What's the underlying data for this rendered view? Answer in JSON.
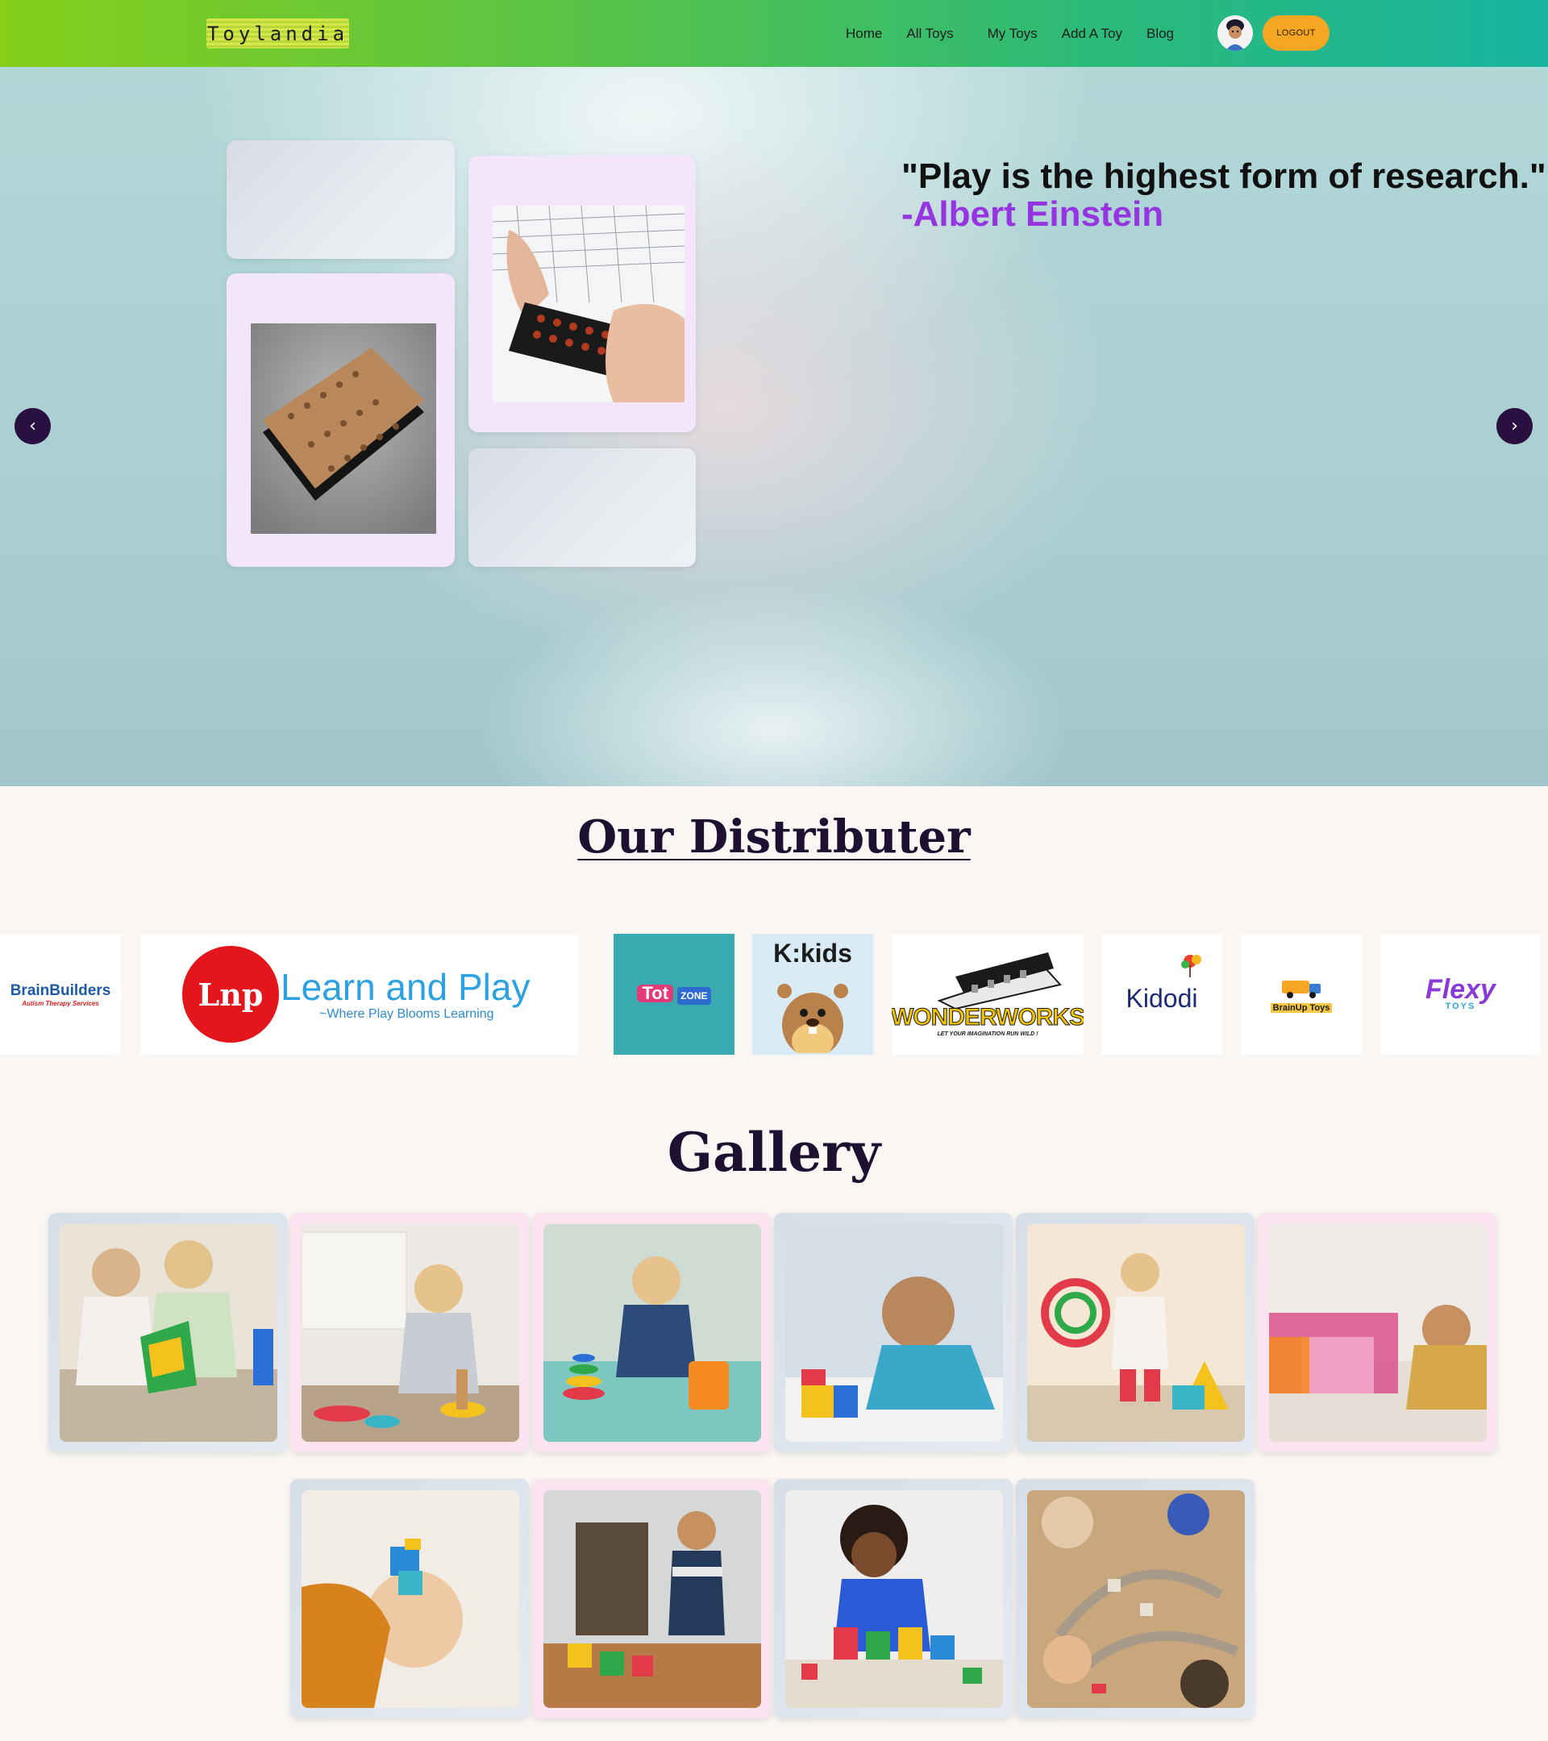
{
  "brand": {
    "name": "Toylandia"
  },
  "nav": {
    "items": [
      {
        "label": "Home"
      },
      {
        "label": "All Toys"
      },
      {
        "label": "My Toys"
      },
      {
        "label": "Add A Toy"
      },
      {
        "label": "Blog"
      }
    ],
    "logout_label": "LOGOUT"
  },
  "hero": {
    "quote": "\"Play is the highest form of research.\"",
    "author": "-Albert Einstein",
    "prev_icon": "chevron-left-icon",
    "next_icon": "chevron-right-icon",
    "prev_glyph": "‹",
    "next_glyph": "›"
  },
  "distributors": {
    "title": "Our Distributer",
    "logos": [
      {
        "name": "BrainBuilders",
        "text": "BrainBuilders",
        "subtext": "Autism Therapy Services"
      },
      {
        "name": "Learn and Play",
        "text": "Learn and Play",
        "subtext": "~Where Play Blooms Learning",
        "mark": "Lnp"
      },
      {
        "name": "Tot Zone",
        "text": "Tot",
        "subtext": "ZONE"
      },
      {
        "name": "K:kids",
        "text": "K:kids"
      },
      {
        "name": "WonderWorks",
        "text": "WONDERWORKS",
        "subtext": "LET YOUR IMAGINATION RUN WILD !"
      },
      {
        "name": "Kidodi",
        "text": "Kidodi"
      },
      {
        "name": "BrainUp Toys",
        "text": "BrainUp Toys"
      },
      {
        "name": "Flexy Toys",
        "text": "Flexy",
        "subtext": "TOYS"
      }
    ]
  },
  "gallery": {
    "title": "Gallery",
    "items": [
      {
        "subject": "kids building magnetic tiles"
      },
      {
        "subject": "toddler with stacking rings"
      },
      {
        "subject": "boy with ring stacker"
      },
      {
        "subject": "smiling boy with blocks"
      },
      {
        "subject": "girl with ferris wheel toy"
      },
      {
        "subject": "child with translucent tiles"
      },
      {
        "subject": "boy holding block to eye"
      },
      {
        "subject": "boy with cube puzzle"
      },
      {
        "subject": "child with building blocks"
      },
      {
        "subject": "kids with train track"
      }
    ]
  },
  "colors": {
    "nav_start": "#86cf1a",
    "nav_end": "#17b49f",
    "logout": "#f5a623",
    "author": "#9534e0",
    "arrow_bg": "#2a1040"
  }
}
